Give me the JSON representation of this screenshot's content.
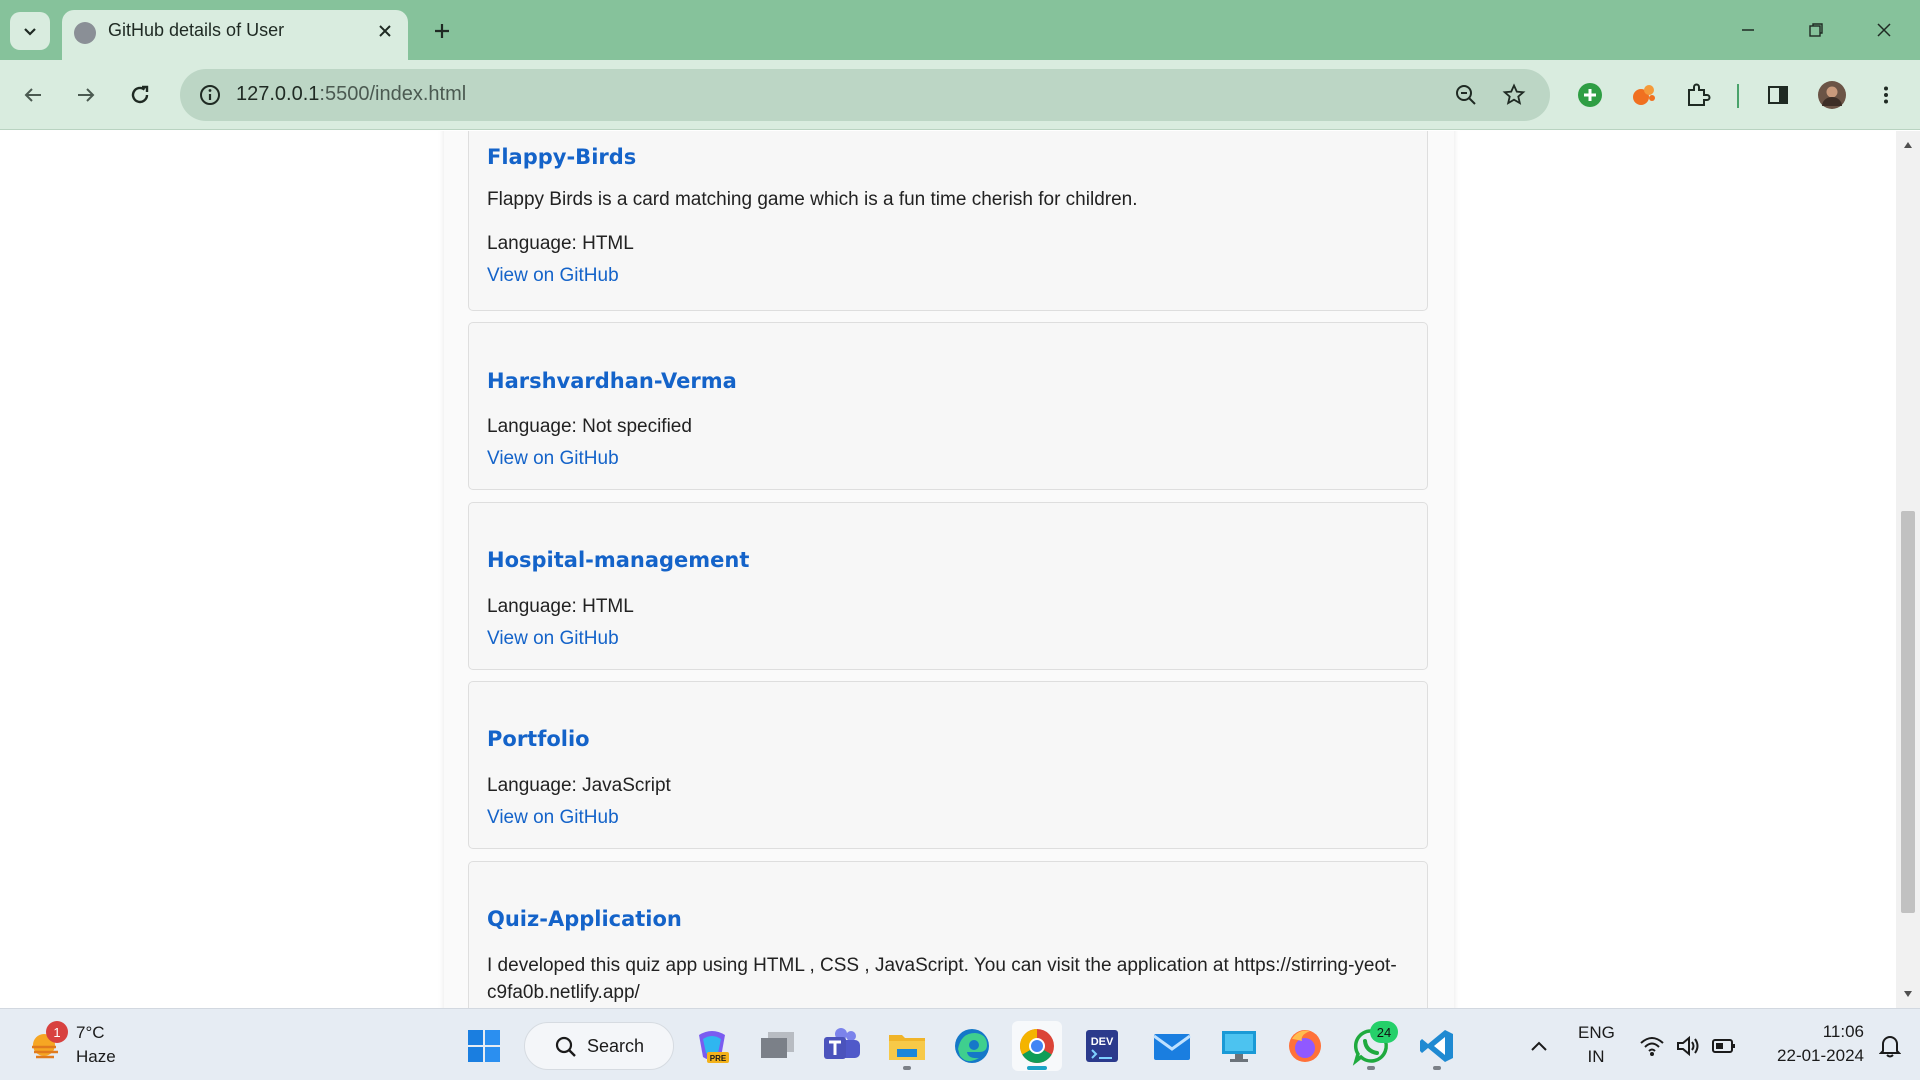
{
  "browser": {
    "tab_title": "GitHub details of User",
    "url_host": "127.0.0.1",
    "url_rest": ":5500/index.html"
  },
  "repos": [
    {
      "name": "Flappy-Birds",
      "description": "Flappy Birds is a card matching game which is a fun time cherish for children.",
      "language": "Language: HTML",
      "link": "View on GitHub"
    },
    {
      "name": "Harshvardhan-Verma",
      "language": "Language: Not specified",
      "link": "View on GitHub"
    },
    {
      "name": "Hospital-management",
      "language": "Language: HTML",
      "link": "View on GitHub"
    },
    {
      "name": "Portfolio",
      "language": "Language: JavaScript",
      "link": "View on GitHub"
    },
    {
      "name": "Quiz-Application",
      "description": "I developed this quiz app using HTML , CSS , JavaScript. You can visit the application at https://stirring-yeot-c9fa0b.netlify.app/"
    }
  ],
  "taskbar": {
    "weather_temp": "7°C",
    "weather_condition": "Haze",
    "weather_badge": "1",
    "search_label": "Search",
    "whatsapp_badge": "24",
    "language_line1": "ENG",
    "language_line2": "IN",
    "time": "11:06",
    "date": "22-01-2024",
    "dev_icon_label": "DEV",
    "pre_label": "PRE"
  },
  "colors": {
    "titlebar": "#86c29b",
    "toolbar": "#d9ecdf",
    "link_blue": "#1463c9"
  }
}
